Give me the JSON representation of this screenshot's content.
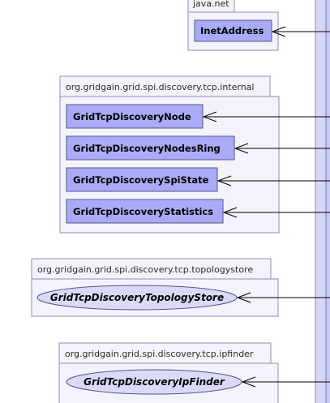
{
  "packages": [
    {
      "name": "java.net",
      "classes": [
        {
          "label": "InetAddress",
          "kind": "class"
        }
      ]
    },
    {
      "name": "org.gridgain.grid.spi.discovery.tcp.internal",
      "classes": [
        {
          "label": "GridTcpDiscoveryNode",
          "kind": "class"
        },
        {
          "label": "GridTcpDiscoveryNodesRing",
          "kind": "class"
        },
        {
          "label": "GridTcpDiscoverySpiState",
          "kind": "class"
        },
        {
          "label": "GridTcpDiscoveryStatistics",
          "kind": "class"
        }
      ]
    },
    {
      "name": "org.gridgain.grid.spi.discovery.tcp.topologystore",
      "classes": [
        {
          "label": "GridTcpDiscoveryTopologyStore",
          "kind": "interface"
        }
      ]
    },
    {
      "name": "org.gridgain.grid.spi.discovery.tcp.ipfinder",
      "classes": [
        {
          "label": "GridTcpDiscoveryIpFinder",
          "kind": "interface"
        }
      ]
    }
  ],
  "colors": {
    "class_fill": "#aaaaf6",
    "interface_fill": "#dadaf8",
    "package_fill": "#f3f3fb",
    "border": "#8c8cb8"
  }
}
